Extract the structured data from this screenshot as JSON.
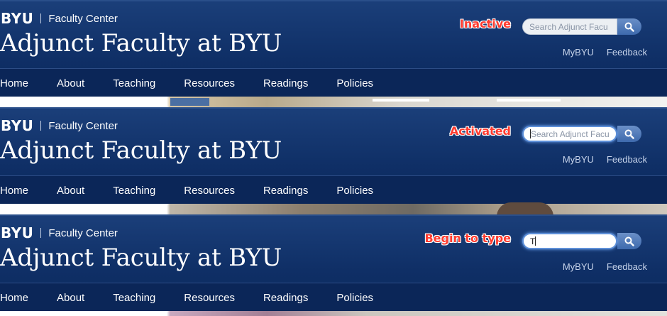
{
  "panels": [
    {
      "brand": {
        "logo": "BYU",
        "center": "Faculty Center"
      },
      "site_title": "Adjunct Faculty at BYU",
      "annotation": "Inactive",
      "search": {
        "placeholder": "Search Adjunct Facu",
        "typed": "",
        "state": "inactive"
      },
      "util_links": [
        "MyBYU",
        "Feedback"
      ],
      "nav": [
        "Home",
        "About",
        "Teaching",
        "Resources",
        "Readings",
        "Policies"
      ]
    },
    {
      "brand": {
        "logo": "BYU",
        "center": "Faculty Center"
      },
      "site_title": "Adjunct Faculty at BYU",
      "annotation": "Activated",
      "search": {
        "placeholder": "Search Adjunct Facu",
        "typed": "",
        "state": "activated"
      },
      "util_links": [
        "MyBYU",
        "Feedback"
      ],
      "nav": [
        "Home",
        "About",
        "Teaching",
        "Resources",
        "Readings",
        "Policies"
      ]
    },
    {
      "brand": {
        "logo": "BYU",
        "center": "Faculty Center"
      },
      "site_title": "Adjunct Faculty at BYU",
      "annotation": "Begin to type",
      "search": {
        "placeholder": "",
        "typed": "T",
        "state": "typing"
      },
      "util_links": [
        "MyBYU",
        "Feedback"
      ],
      "nav": [
        "Home",
        "About",
        "Teaching",
        "Resources",
        "Readings",
        "Policies"
      ]
    }
  ],
  "colors": {
    "header_blue": "#0f2f66",
    "nav_blue": "#0b2658",
    "annotation_red": "#ff3b2f",
    "focus_glow": "#6aa1f0"
  },
  "icons": {
    "search_button": "search-icon"
  }
}
